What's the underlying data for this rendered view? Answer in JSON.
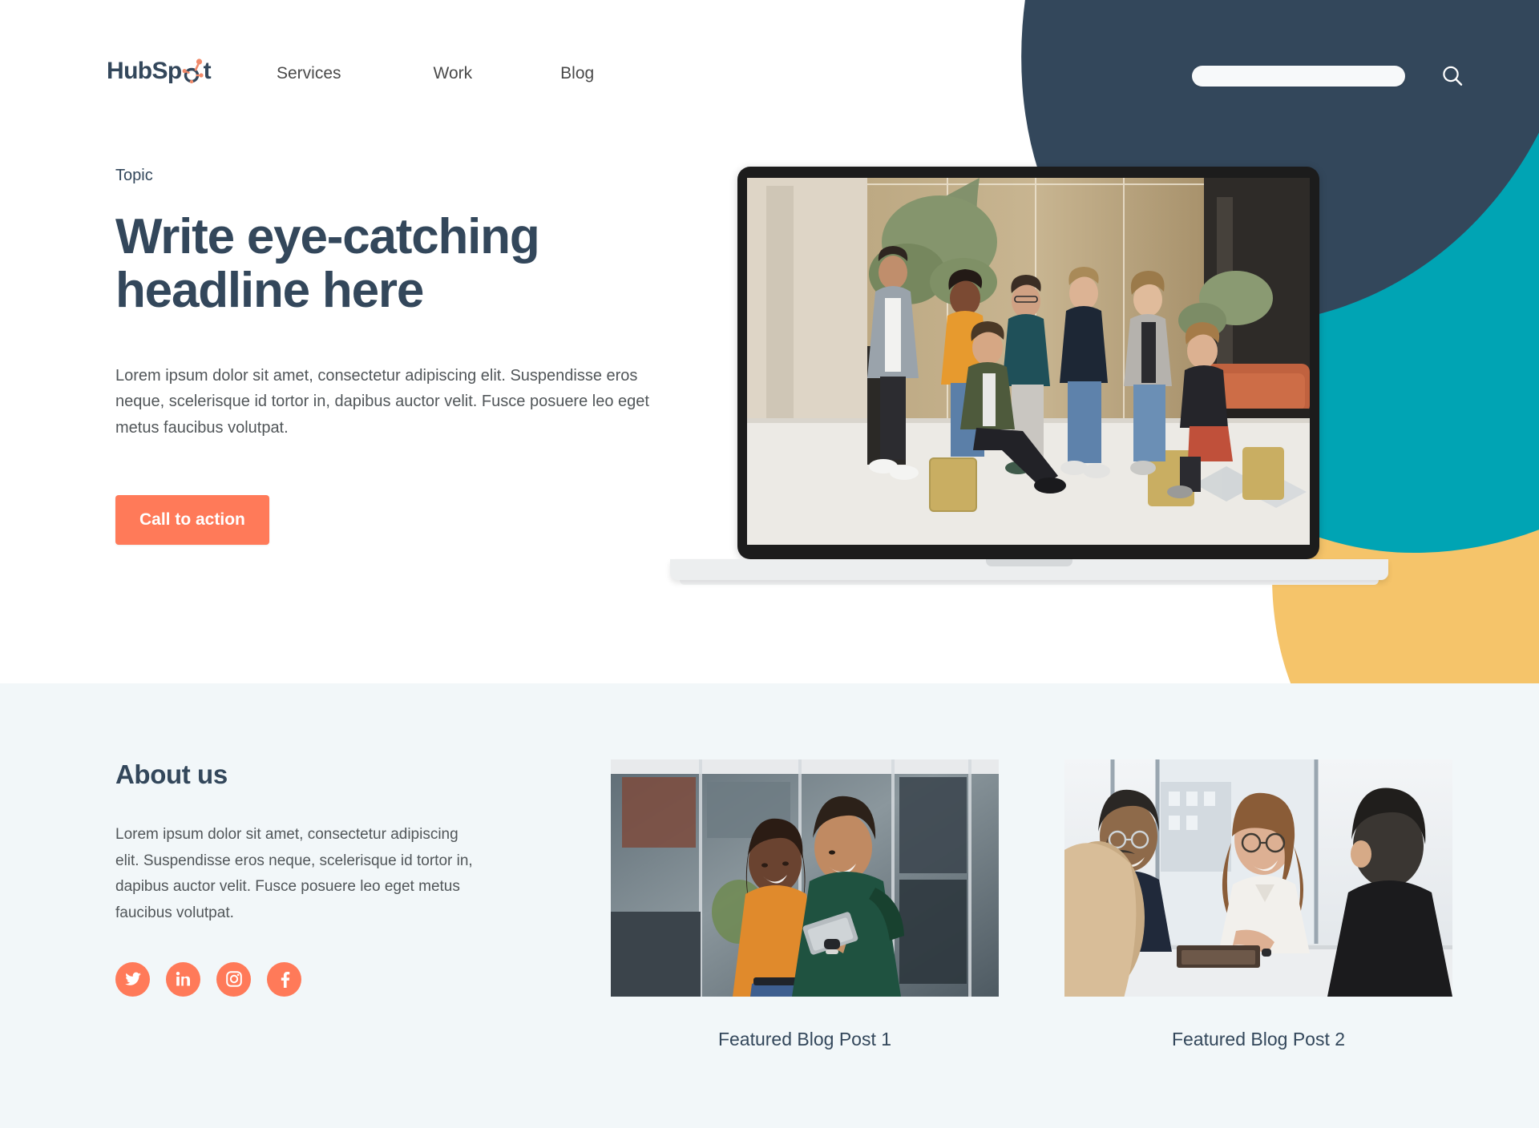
{
  "brand": {
    "logo_text_1": "HubSp",
    "logo_text_2": "t",
    "logo_name": "HubSpot",
    "accent_orange": "#ff7a59",
    "navy": "#33475b",
    "teal": "#00a4b4",
    "yellow": "#f5c46a",
    "section_bg": "#f2f7f9"
  },
  "header": {
    "nav_items": [
      {
        "label": "Services"
      },
      {
        "label": "Work"
      },
      {
        "label": "Blog"
      }
    ],
    "search": {
      "value": "",
      "placeholder": ""
    },
    "search_icon": "search-icon"
  },
  "hero": {
    "eyebrow": "Topic",
    "headline": "Write eye-catching headline here",
    "paragraph": "Lorem ipsum dolor sit amet, consectetur adipiscing elit. Suspendisse eros neque, scelerisque id tortor in, dapibus auctor velit. Fusce posuere leo eget metus faucibus volutpat.",
    "cta_label": "Call to action",
    "laptop_image_alt": "Team of seven colleagues posing in a modern coworking office"
  },
  "about": {
    "title": "About us",
    "paragraph": "Lorem ipsum dolor sit amet, consectetur adipiscing elit. Suspendisse eros neque, scelerisque id tortor in, dapibus auctor velit. Fusce posuere leo eget metus faucibus volutpat.",
    "socials": [
      {
        "name": "twitter-icon",
        "label": "Twitter"
      },
      {
        "name": "linkedin-icon",
        "label": "LinkedIn"
      },
      {
        "name": "instagram-icon",
        "label": "Instagram"
      },
      {
        "name": "facebook-icon",
        "label": "Facebook"
      }
    ]
  },
  "blog": {
    "posts": [
      {
        "caption": "Featured Blog Post 1",
        "image_alt": "Two colleagues smiling while looking at a tablet together"
      },
      {
        "caption": "Featured Blog Post 2",
        "image_alt": "Colleagues laughing around a meeting table by a window"
      }
    ]
  }
}
